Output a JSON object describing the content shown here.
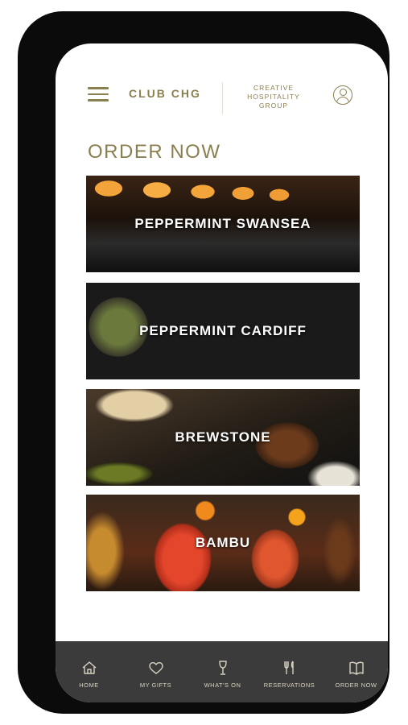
{
  "header": {
    "brand": "CLUB CHG",
    "group_logo_lines": [
      "CREATIVE",
      "HOSPITALITY",
      "GROUP"
    ],
    "menu_icon": "hamburger-menu-icon",
    "account_icon": "user-account-icon"
  },
  "main": {
    "section_title": "ORDER NOW",
    "venues": [
      {
        "label": "PEPPERMINT SWANSEA"
      },
      {
        "label": "PEPPERMINT CARDIFF"
      },
      {
        "label": "BREWSTONE"
      },
      {
        "label": "BAMBU"
      }
    ]
  },
  "nav": {
    "items": [
      {
        "label": "HOME",
        "icon": "home-icon"
      },
      {
        "label": "MY GIFTS",
        "icon": "heart-icon"
      },
      {
        "label": "WHAT'S ON",
        "icon": "wine-glass-icon"
      },
      {
        "label": "RESERVATIONS",
        "icon": "cutlery-icon"
      },
      {
        "label": "ORDER NOW",
        "icon": "book-menu-icon"
      }
    ]
  },
  "colors": {
    "accent": "#8a7f4f",
    "nav_background": "#3b3b3b",
    "nav_text": "#d8d3c0",
    "phone_frame": "#0b0b0b"
  }
}
